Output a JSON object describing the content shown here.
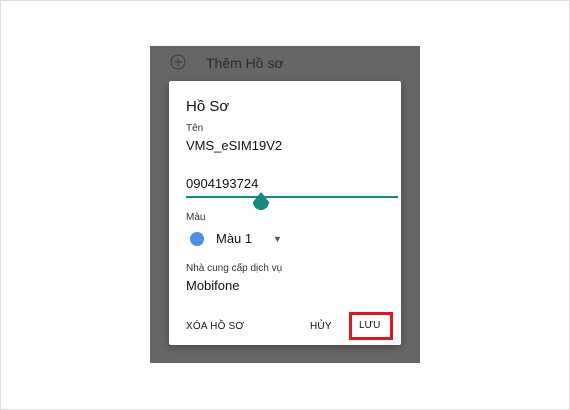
{
  "header": {
    "add_profile_label": "Thêm Hồ sơ",
    "add_icon": "plus-circle-icon"
  },
  "dialog": {
    "title": "Hồ Sơ",
    "name_label": "Tên",
    "name_value": "VMS_eSIM19V2",
    "phone_value": "0904193724",
    "color_label": "Màu",
    "color_value": "Màu 1",
    "color_swatch": "#4a8fe7",
    "provider_label": "Nhà cung cấp dịch vụ",
    "provider_value": "Mobifone",
    "delete_button": "XÓA HỒ SƠ",
    "cancel_button": "HỦY",
    "save_button": "LƯU"
  },
  "colors": {
    "accent": "#148a7a",
    "highlight_box": "#e3141c",
    "overlay": "#666666"
  }
}
